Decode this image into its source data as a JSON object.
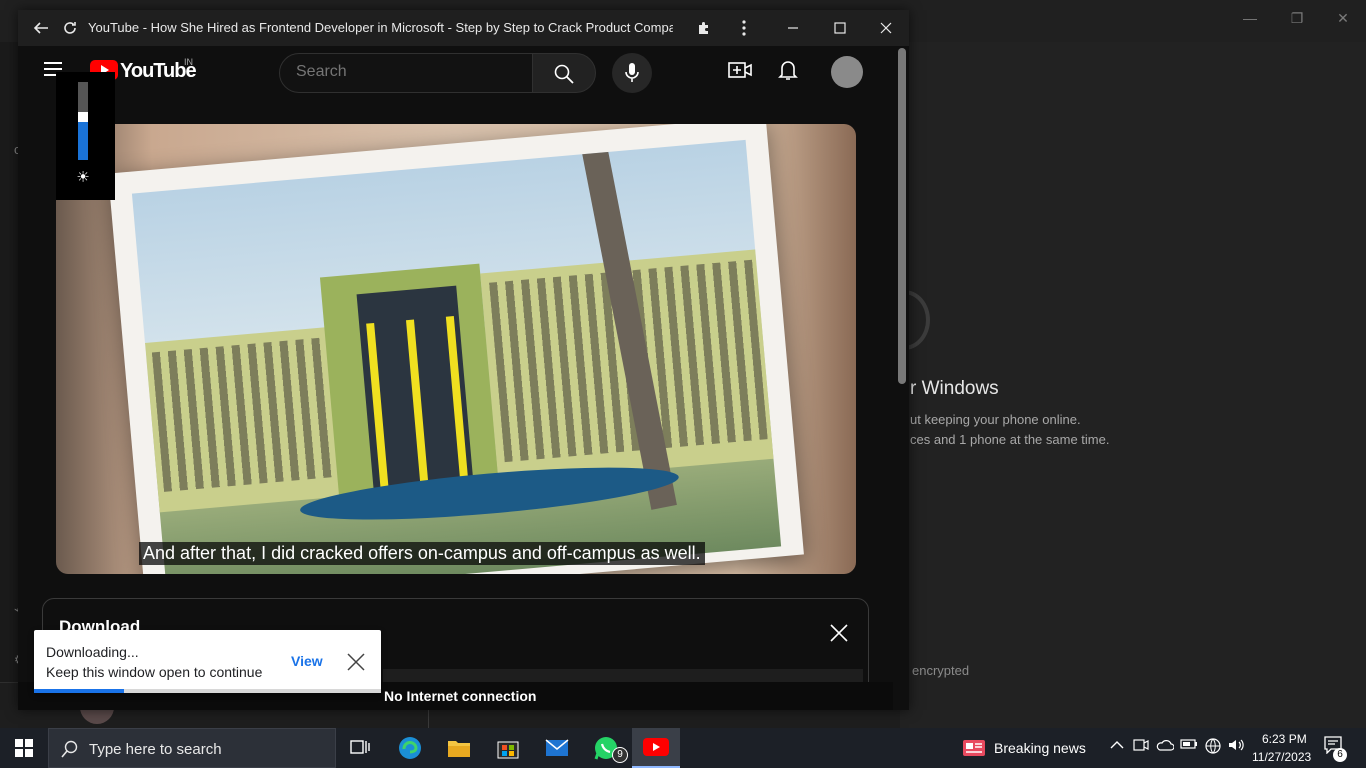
{
  "background_app": {
    "heading": "r Windows",
    "line1": "ut keeping your phone online.",
    "line2": "ces and 1 phone at the same time.",
    "encrypted": "encrypted"
  },
  "window": {
    "title": "YouTube - How She Hired as Frontend Developer in Microsoft - Step by Step to Crack Product Companies in..."
  },
  "youtube": {
    "logo_text": "YouTube",
    "country": "IN",
    "search_placeholder": "Search"
  },
  "brightness": {
    "level": 0.55
  },
  "video": {
    "caption": "And after that, I did cracked offers on-campus and off-campus as well."
  },
  "download_panel": {
    "title": "Download"
  },
  "offline_bar": {
    "text": "No Internet connection"
  },
  "toast": {
    "line1": "Downloading...",
    "line2": "Keep this window open to continue",
    "view_label": "View",
    "progress": 0.26
  },
  "taskbar": {
    "search_placeholder": "Type here to search",
    "whatsapp_badge": "9",
    "news": "Breaking news",
    "time": "6:23 PM",
    "date": "11/27/2023",
    "notifications": "6"
  },
  "colors": {
    "youtube_red": "#ff0000",
    "accent_blue": "#1a73e8",
    "window_bg": "#0f0f0f"
  }
}
